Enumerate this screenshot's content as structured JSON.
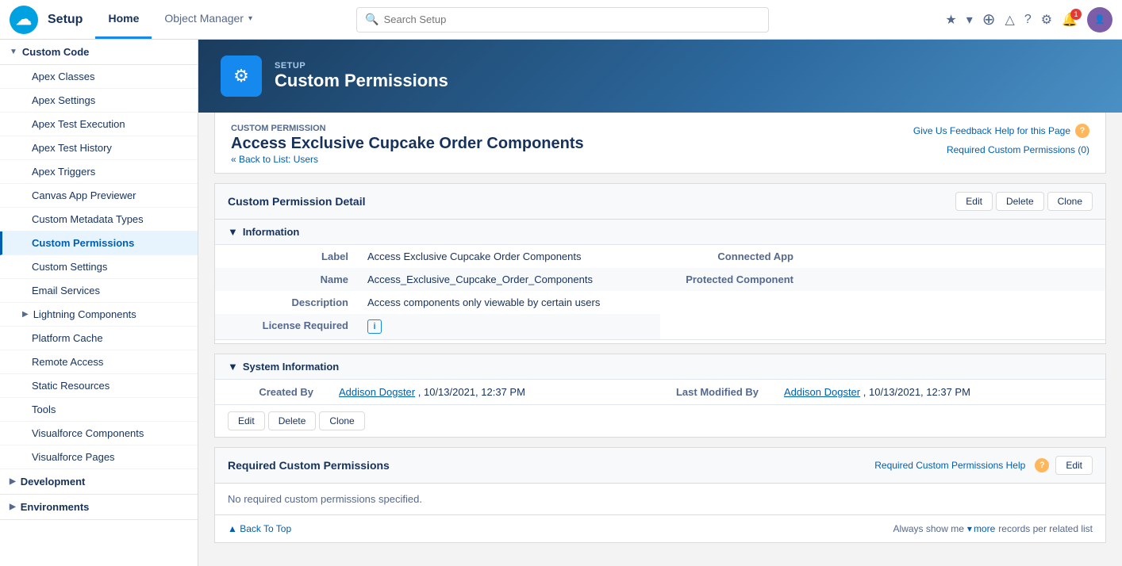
{
  "topNav": {
    "logo": "☁",
    "setupLabel": "Setup",
    "tabs": [
      {
        "id": "home",
        "label": "Home",
        "active": true
      },
      {
        "id": "object-manager",
        "label": "Object Manager",
        "hasChevron": true
      }
    ],
    "search": {
      "placeholder": "Search Setup"
    },
    "icons": {
      "star": "★",
      "chevron": "▾",
      "add": "+",
      "cloud": "☁",
      "help": "?",
      "gear": "⚙",
      "bell": "🔔",
      "notificationCount": "1"
    }
  },
  "sidebar": {
    "sections": [
      {
        "id": "custom-code",
        "label": "Custom Code",
        "expanded": true,
        "items": [
          {
            "id": "apex-classes",
            "label": "Apex Classes",
            "active": false
          },
          {
            "id": "apex-settings",
            "label": "Apex Settings",
            "active": false
          },
          {
            "id": "apex-test-execution",
            "label": "Apex Test Execution",
            "active": false
          },
          {
            "id": "apex-test-history",
            "label": "Apex Test History",
            "active": false
          },
          {
            "id": "apex-triggers",
            "label": "Apex Triggers",
            "active": false
          },
          {
            "id": "canvas-app-previewer",
            "label": "Canvas App Previewer",
            "active": false
          },
          {
            "id": "custom-metadata-types",
            "label": "Custom Metadata Types",
            "active": false
          },
          {
            "id": "custom-permissions",
            "label": "Custom Permissions",
            "active": true
          },
          {
            "id": "custom-settings",
            "label": "Custom Settings",
            "active": false
          },
          {
            "id": "email-services",
            "label": "Email Services",
            "active": false
          },
          {
            "id": "lightning-components",
            "label": "Lightning Components",
            "active": false,
            "hasArrow": true
          },
          {
            "id": "platform-cache",
            "label": "Platform Cache",
            "active": false
          },
          {
            "id": "remote-access",
            "label": "Remote Access",
            "active": false
          },
          {
            "id": "static-resources",
            "label": "Static Resources",
            "active": false
          },
          {
            "id": "tools",
            "label": "Tools",
            "active": false
          },
          {
            "id": "visualforce-components",
            "label": "Visualforce Components",
            "active": false
          },
          {
            "id": "visualforce-pages",
            "label": "Visualforce Pages",
            "active": false
          }
        ]
      },
      {
        "id": "development",
        "label": "Development",
        "expanded": false,
        "items": []
      },
      {
        "id": "environments",
        "label": "Environments",
        "expanded": false,
        "items": []
      }
    ]
  },
  "pageHeader": {
    "setupTag": "SETUP",
    "title": "Custom Permissions",
    "icon": "⚙"
  },
  "record": {
    "subtitle": "Custom Permission",
    "title": "Access Exclusive Cupcake Order Components",
    "backLink": "« Back to List: Users",
    "feedbackLink": "Give Us Feedback",
    "helpLink": "Help for this Page",
    "requiredPermissionsLink": "Required Custom Permissions (0)"
  },
  "permissionDetail": {
    "sectionTitle": "Custom Permission Detail",
    "buttons": [
      "Edit",
      "Delete",
      "Clone"
    ],
    "infoSectionTitle": "Information",
    "fields": {
      "label": "Access Exclusive Cupcake Order Components",
      "name": "Access_Exclusive_Cupcake_Order_Components",
      "description": "Access components only viewable by certain users",
      "licenseRequired": "i",
      "connectedApp": "",
      "protectedComponent": ""
    },
    "labels": {
      "label": "Label",
      "name": "Name",
      "description": "Description",
      "licenseRequired": "License Required",
      "connectedApp": "Connected App",
      "protectedComponent": "Protected Component"
    }
  },
  "systemInfo": {
    "sectionTitle": "System Information",
    "createdByLabel": "Created By",
    "createdBy": "Addison Dogster",
    "createdDate": "10/13/2021, 12:37 PM",
    "lastModifiedByLabel": "Last Modified By",
    "lastModifiedBy": "Addison Dogster",
    "lastModifiedDate": "10/13/2021, 12:37 PM",
    "buttons": [
      "Edit",
      "Delete",
      "Clone"
    ]
  },
  "requiredPermissions": {
    "sectionTitle": "Required Custom Permissions",
    "editButton": "Edit",
    "helpLink": "Required Custom Permissions Help",
    "noDataMessage": "No required custom permissions specified.",
    "footer": {
      "backToTop": "▲ Back To Top",
      "alwaysShow": "Always show me",
      "moreIcon": "▾",
      "more": "more",
      "perRelatedList": "records per related list"
    }
  }
}
